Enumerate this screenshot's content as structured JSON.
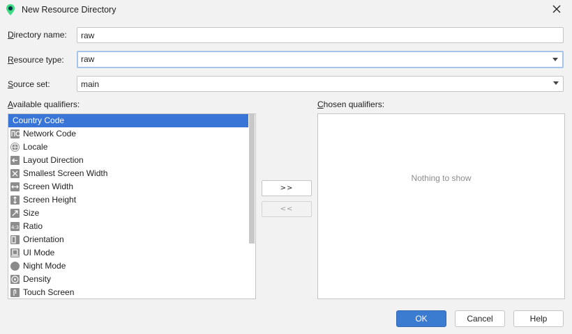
{
  "window": {
    "title": "New Resource Directory",
    "app_icon": "android-studio-icon",
    "close_icon": "close-icon"
  },
  "form": {
    "directory_name": {
      "label_mnemonic": "D",
      "label_rest": "irectory name:",
      "value": "raw"
    },
    "resource_type": {
      "label_mnemonic": "R",
      "label_rest": "esource type:",
      "value": "raw"
    },
    "source_set": {
      "label_mnemonic": "S",
      "label_rest": "ource set:",
      "value": "main"
    }
  },
  "available": {
    "label_pre": "A",
    "label_rest": "vailable qualifiers:",
    "items": [
      {
        "label": "Country Code",
        "icon": "country-code-icon",
        "selected": true
      },
      {
        "label": "Network Code",
        "icon": "network-code-icon"
      },
      {
        "label": "Locale",
        "icon": "globe-icon"
      },
      {
        "label": "Layout Direction",
        "icon": "layout-direction-icon"
      },
      {
        "label": "Smallest Screen Width",
        "icon": "smallest-width-icon"
      },
      {
        "label": "Screen Width",
        "icon": "screen-width-icon"
      },
      {
        "label": "Screen Height",
        "icon": "screen-height-icon"
      },
      {
        "label": "Size",
        "icon": "size-icon"
      },
      {
        "label": "Ratio",
        "icon": "ratio-icon"
      },
      {
        "label": "Orientation",
        "icon": "orientation-icon"
      },
      {
        "label": "UI Mode",
        "icon": "ui-mode-icon"
      },
      {
        "label": "Night Mode",
        "icon": "night-mode-icon"
      },
      {
        "label": "Density",
        "icon": "density-icon"
      },
      {
        "label": "Touch Screen",
        "icon": "touch-screen-icon"
      }
    ]
  },
  "chosen": {
    "label_pre": "C",
    "label_rest": "hosen qualifiers:",
    "empty_text": "Nothing to show"
  },
  "transfer": {
    "add_label": ">>",
    "remove_label": "<<"
  },
  "buttons": {
    "ok": "OK",
    "cancel": "Cancel",
    "help": "Help"
  },
  "colors": {
    "selection": "#3875d7",
    "primary_button": "#3c7cd0",
    "focus_border": "#a6c4ea"
  }
}
